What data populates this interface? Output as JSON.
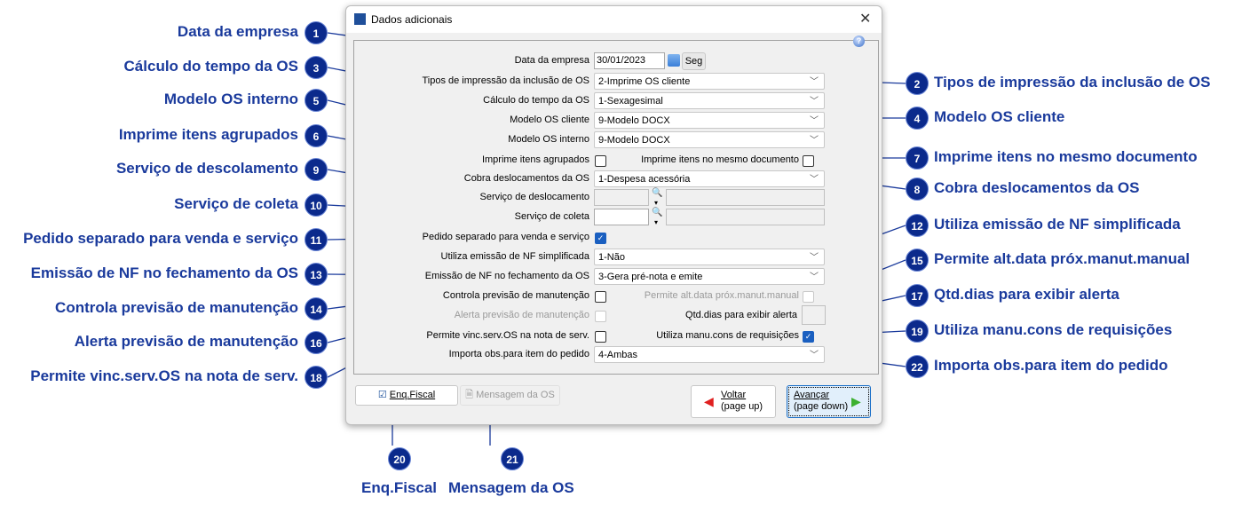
{
  "dialog": {
    "title": "Dados adicionais",
    "close": "✕",
    "help": "?"
  },
  "form": {
    "data_empresa": {
      "label": "Data da empresa",
      "value": "30/01/2023",
      "weekday": "Seg"
    },
    "tipos_impressao": {
      "label": "Tipos de impressão da inclusão de OS",
      "value": "2-Imprime OS cliente"
    },
    "calculo_tempo": {
      "label": "Cálculo do tempo da OS",
      "value": "1-Sexagesimal"
    },
    "modelo_cliente": {
      "label": "Modelo OS cliente",
      "value": "9-Modelo DOCX"
    },
    "modelo_interno": {
      "label": "Modelo OS interno",
      "value": "9-Modelo DOCX"
    },
    "imprime_agrupados": {
      "label": "Imprime itens agrupados",
      "checked": false
    },
    "imprime_mesmo_doc": {
      "label": "Imprime itens no mesmo documento",
      "checked": false
    },
    "cobra_deslocamentos": {
      "label": "Cobra deslocamentos da OS",
      "value": "1-Despesa acessória"
    },
    "servico_deslocamento": {
      "label": "Serviço de deslocamento",
      "value": ""
    },
    "servico_coleta": {
      "label": "Serviço de coleta",
      "value": ""
    },
    "pedido_separado": {
      "label": "Pedido separado para venda e serviço",
      "checked": true
    },
    "nf_simplificada": {
      "label": "Utiliza emissão de NF simplificada",
      "value": "1-Não"
    },
    "nf_fechamento": {
      "label": "Emissão de NF no fechamento da OS",
      "value": "3-Gera pré-nota e emite"
    },
    "controla_previsao": {
      "label": "Controla previsão de manutenção",
      "checked": false
    },
    "permite_alt_data": {
      "label": "Permite alt.data próx.manut.manual",
      "checked": false
    },
    "alerta_previsao": {
      "label": "Alerta previsão de manutenção",
      "checked": false
    },
    "qtd_dias": {
      "label": "Qtd.dias para exibir alerta",
      "value": ""
    },
    "permite_vinc": {
      "label": "Permite vinc.serv.OS na nota de serv.",
      "checked": false
    },
    "utiliza_manu": {
      "label": "Utiliza manu.cons de requisições",
      "checked": true
    },
    "importa_obs": {
      "label": "Importa obs.para item do pedido",
      "value": "4-Ambas"
    }
  },
  "buttons": {
    "enq_fiscal": "Enq.Fiscal",
    "mensagem": "Mensagem da OS",
    "voltar1": "Voltar",
    "voltar2": "(page up)",
    "avancar1": "Avançar",
    "avancar2": "(page down)"
  },
  "callouts": [
    {
      "n": "1",
      "text": "Data da empresa"
    },
    {
      "n": "3",
      "text": "Cálculo do tempo da OS"
    },
    {
      "n": "5",
      "text": "Modelo OS interno"
    },
    {
      "n": "6",
      "text": "Imprime itens agrupados"
    },
    {
      "n": "9",
      "text": "Serviço de descolamento"
    },
    {
      "n": "10",
      "text": "Serviço de coleta"
    },
    {
      "n": "11",
      "text": "Pedido separado para venda e serviço"
    },
    {
      "n": "13",
      "text": "Emissão de NF no fechamento da OS"
    },
    {
      "n": "14",
      "text": "Controla previsão de manutenção"
    },
    {
      "n": "16",
      "text": "Alerta previsão de manutenção"
    },
    {
      "n": "18",
      "text": "Permite vinc.serv.OS na nota de serv."
    },
    {
      "n": "2",
      "text": "Tipos de impressão da inclusão de OS"
    },
    {
      "n": "4",
      "text": "Modelo OS cliente"
    },
    {
      "n": "7",
      "text": "Imprime itens no mesmo documento"
    },
    {
      "n": "8",
      "text": "Cobra deslocamentos da OS"
    },
    {
      "n": "12",
      "text": "Utiliza emissão de NF simplificada"
    },
    {
      "n": "15",
      "text": "Permite alt.data próx.manut.manual"
    },
    {
      "n": "17",
      "text": "Qtd.dias para exibir alerta"
    },
    {
      "n": "19",
      "text": "Utiliza manu.cons de requisições"
    },
    {
      "n": "22",
      "text": "Importa obs.para item do pedido"
    },
    {
      "n": "20",
      "text": "Enq.Fiscal"
    },
    {
      "n": "21",
      "text": "Mensagem da OS"
    }
  ]
}
